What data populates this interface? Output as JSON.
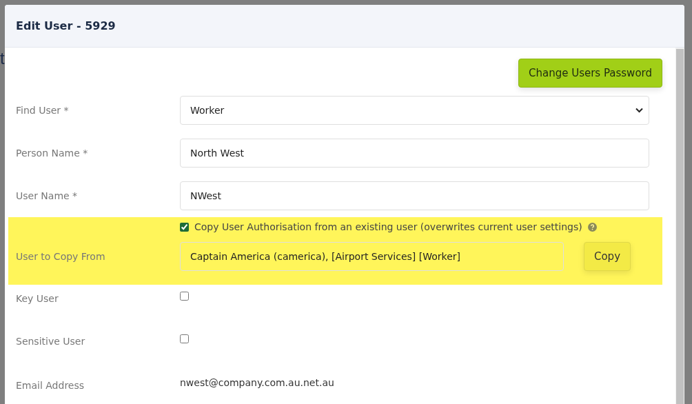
{
  "background_text": "t",
  "dialog": {
    "title": "Edit User - 5929",
    "action_button": "Change Users Password"
  },
  "fields": [
    {
      "kind": "select",
      "label": "Find User *",
      "value": "Worker"
    },
    {
      "kind": "text",
      "label": "Person Name *",
      "value": "North West"
    },
    {
      "kind": "text",
      "label": "User Name *",
      "value": "NWest"
    }
  ],
  "copy_section": {
    "highlighted": true,
    "checkbox_label": "Copy User Authorisation from an existing user (overwrites current user settings)",
    "checked": true,
    "label": "User to Copy From",
    "value": "Captain America (camerica), [Airport Services] [Worker]",
    "button": "Copy"
  },
  "options": [
    {
      "kind": "checkbox",
      "label": "Key User",
      "checked": false
    },
    {
      "kind": "checkbox",
      "label": "Sensitive User",
      "checked": false
    },
    {
      "kind": "static",
      "label": "Email Address",
      "value": "nwest@company.com.au.net.au"
    }
  ]
}
